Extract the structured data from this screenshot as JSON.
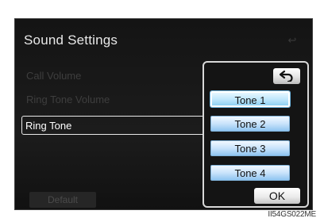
{
  "screen": {
    "title": "Sound Settings",
    "menu": [
      {
        "label": "Call Volume",
        "state": "dim"
      },
      {
        "label": "Ring Tone Volume",
        "state": "dim"
      },
      {
        "label": "Ring Tone",
        "state": "active"
      }
    ],
    "default_label": "Default"
  },
  "popup": {
    "tones": [
      "Tone 1",
      "Tone 2",
      "Tone 3",
      "Tone 4"
    ],
    "selected_tone": "Tone 1",
    "ok_label": "OK",
    "back_icon": "back-arrow-icon"
  },
  "caption": "II54GS022ME",
  "colors": {
    "screen_bg": "#161616",
    "tone_button": "#b7dbf7",
    "highlight_border": "#ffffff"
  }
}
